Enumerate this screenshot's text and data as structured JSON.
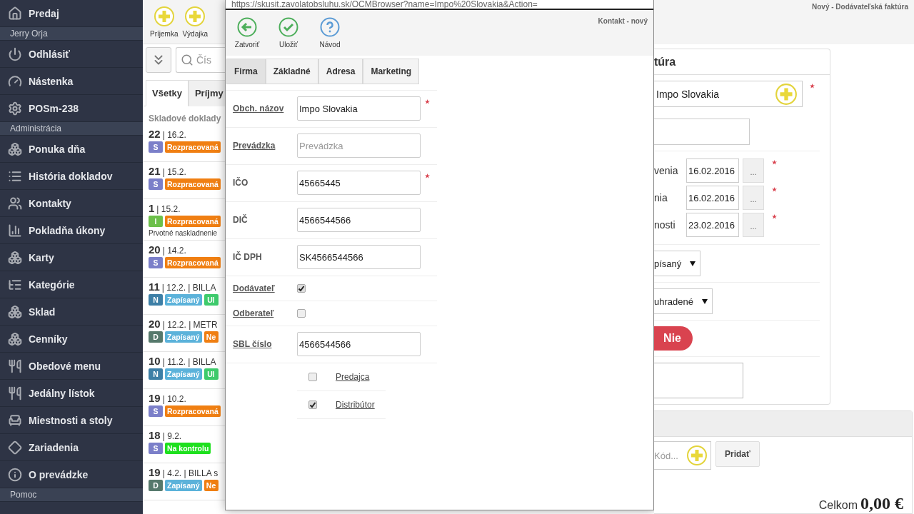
{
  "sidebar": {
    "items": [
      {
        "kind": "item",
        "label": "Predaj"
      },
      {
        "kind": "header",
        "label": "Jerry Orja"
      },
      {
        "kind": "item",
        "label": "Odhlásiť"
      },
      {
        "kind": "item",
        "label": "Nástenka"
      },
      {
        "kind": "item",
        "label": "POSm-238"
      },
      {
        "kind": "header",
        "label": "Administrácia"
      },
      {
        "kind": "item",
        "label": "Ponuka dňa"
      },
      {
        "kind": "item",
        "label": "História dokladov"
      },
      {
        "kind": "item",
        "label": "Kontakty"
      },
      {
        "kind": "item",
        "label": "Pokladňa úkony"
      },
      {
        "kind": "item",
        "label": "Karty"
      },
      {
        "kind": "item",
        "label": "Kategórie"
      },
      {
        "kind": "item",
        "label": "Sklad"
      },
      {
        "kind": "item",
        "label": "Cenníky"
      },
      {
        "kind": "item",
        "label": "Obedové menu"
      },
      {
        "kind": "item",
        "label": "Jedálny lístok"
      },
      {
        "kind": "item",
        "label": "Miestnosti a stoly"
      },
      {
        "kind": "item",
        "label": "Zariadenia"
      },
      {
        "kind": "item",
        "label": "O prevádzke"
      },
      {
        "kind": "header",
        "label": "Pomoc"
      }
    ]
  },
  "documents": {
    "toolbar": [
      {
        "label": "Príjemka"
      },
      {
        "label": "Výdajka"
      }
    ],
    "search": {
      "placeholder": "Čís"
    },
    "tabs": [
      {
        "label": "Všetky",
        "selected": true
      },
      {
        "label": "Príjmy",
        "selected": false
      }
    ],
    "heading": "Skladové doklady",
    "rows": [
      {
        "number": "22",
        "details": "| 16.2.",
        "badges": [
          {
            "text": "S",
            "color": "#7b7fc9"
          },
          {
            "text": "Rozpracovaná",
            "color": "#f07f12"
          }
        ]
      },
      {
        "number": "21",
        "details": "| 15.2.",
        "badges": [
          {
            "text": "S",
            "color": "#7b7fc9"
          },
          {
            "text": "Rozpracovaná",
            "color": "#f07f12"
          }
        ]
      },
      {
        "number": "1",
        "details": "| 15.2.",
        "badges": [
          {
            "text": "I",
            "color": "#6cc04a"
          },
          {
            "text": "Rozpracovaná",
            "color": "#f07f12"
          }
        ],
        "note": "Prvotné naskladnenie"
      },
      {
        "number": "20",
        "details": "| 14.2.",
        "badges": [
          {
            "text": "S",
            "color": "#7b7fc9"
          },
          {
            "text": "Rozpracovaná",
            "color": "#f07f12"
          }
        ]
      },
      {
        "number": "11",
        "details": "| 12.2. | BILLA",
        "badges": [
          {
            "text": "N",
            "color": "#3d7fa6"
          },
          {
            "text": "Zapísaný",
            "color": "#5bb2da"
          },
          {
            "text": "Ul",
            "color": "#3ecb6c"
          }
        ]
      },
      {
        "number": "20",
        "details": "| 12.2. | METR",
        "badges": [
          {
            "text": "D",
            "color": "#56796c"
          },
          {
            "text": "Zapísaný",
            "color": "#5bb2da"
          },
          {
            "text": "Ne",
            "color": "#f07f12"
          }
        ]
      },
      {
        "number": "10",
        "details": "| 11.2. | BILLA",
        "badges": [
          {
            "text": "N",
            "color": "#3d7fa6"
          },
          {
            "text": "Zapísaný",
            "color": "#5bb2da"
          },
          {
            "text": "Ul",
            "color": "#3ecb6c"
          }
        ]
      },
      {
        "number": "19",
        "details": "| 10.2.",
        "badges": [
          {
            "text": "S",
            "color": "#7b7fc9"
          },
          {
            "text": "Rozpracovaná",
            "color": "#f07f12"
          }
        ]
      },
      {
        "number": "18",
        "details": "| 9.2.",
        "badges": [
          {
            "text": "S",
            "color": "#7b7fc9"
          },
          {
            "text": "Na kontrolu",
            "color": "#1ee01e"
          }
        ]
      },
      {
        "number": "19",
        "details": "| 4.2. | BILLA s",
        "badges": [
          {
            "text": "D",
            "color": "#56796c"
          },
          {
            "text": "Zapísaný",
            "color": "#5bb2da"
          },
          {
            "text": "Ne",
            "color": "#f07f12"
          }
        ]
      }
    ]
  },
  "dialog": {
    "url": "https://skusit.zavolatobsluhu.sk/OCMBrowser?name=Impo%20Slovakia&Action=",
    "title": "Kontakt - nový",
    "actions": [
      {
        "kind": "back",
        "label": "Zatvoriť"
      },
      {
        "kind": "save",
        "label": "Uložiť"
      },
      {
        "kind": "help",
        "label": "Návod"
      }
    ],
    "tabs": [
      {
        "label": "Firma",
        "selected": true
      },
      {
        "label": "Základné",
        "selected": false
      },
      {
        "label": "Adresa",
        "selected": false
      },
      {
        "label": "Marketing",
        "selected": false
      }
    ],
    "fields": [
      {
        "kind": "text",
        "label": "Obch. názov",
        "link": true,
        "value": "Impo Slovakia",
        "required": true
      },
      {
        "kind": "text",
        "label": "Prevádzka",
        "link": true,
        "placeholder": "Prevádzka"
      },
      {
        "kind": "text",
        "label": "IČO",
        "link": false,
        "value": "45665445",
        "required": true
      },
      {
        "kind": "text",
        "label": "DIČ",
        "link": false,
        "value": "4566544566"
      },
      {
        "kind": "text",
        "label": "IČ DPH",
        "link": false,
        "value": "SK4566544566"
      },
      {
        "kind": "checkbox",
        "label": "Dodávateľ",
        "link": true,
        "checked": true
      },
      {
        "kind": "checkbox",
        "label": "Odberateľ",
        "link": true,
        "checked": false
      },
      {
        "kind": "text",
        "label": "SBL číslo",
        "link": true,
        "value": "4566544566",
        "options": [
          {
            "label": "Predajca",
            "checked": false
          },
          {
            "label": "Distribútor",
            "checked": true
          }
        ]
      }
    ]
  },
  "invoice": {
    "page_title": "Nový - Dodávateľská faktúra",
    "card_title": "túra",
    "supplier": {
      "value": "Impo Slovakia",
      "required": true
    },
    "dates": [
      {
        "label": "venia",
        "value": "16.02.2016",
        "button": "...",
        "required": true
      },
      {
        "label": "nia",
        "value": "16.02.2016",
        "button": "...",
        "required": true
      },
      {
        "label": "nosti",
        "value": "23.02.2016",
        "button": "...",
        "required": true
      }
    ],
    "selects": [
      {
        "value": "písaný"
      },
      {
        "value": "uhradené"
      }
    ],
    "paid_toggle": {
      "label": "Nie",
      "on": false
    },
    "items": {
      "code_placeholder": "Kód...",
      "add_button": "Pridať",
      "total_label": "Celkom",
      "total_value": "0,00 €"
    }
  }
}
